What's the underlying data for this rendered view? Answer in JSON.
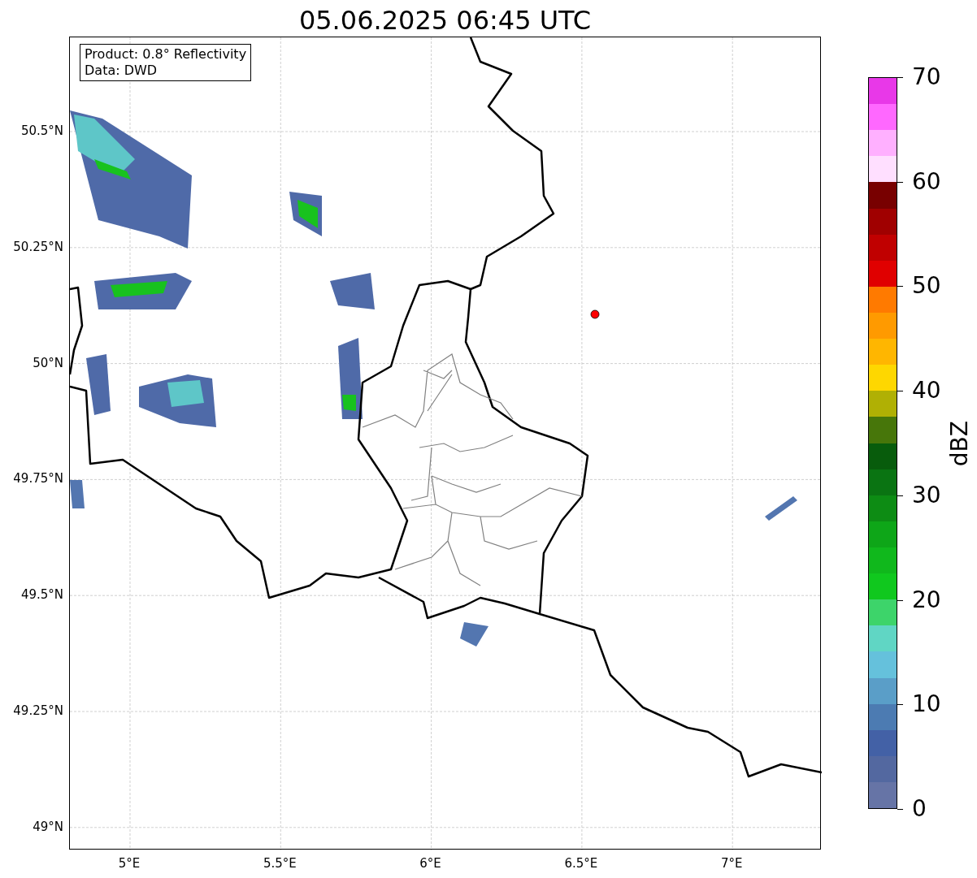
{
  "title": "05.06.2025 06:45 UTC",
  "info_box": {
    "lines": [
      "Product: 0.8° Reflectivity",
      "Data: DWD"
    ]
  },
  "map": {
    "y_ticks": [
      "50.5°N",
      "50.25°N",
      "50°N",
      "49.75°N",
      "49.5°N",
      "49.25°N",
      "49°N"
    ],
    "x_ticks": [
      "5°E",
      "5.5°E",
      "6°E",
      "6.5°E",
      "7°E"
    ]
  },
  "colorbar": {
    "label": "dBZ",
    "ticks": [
      "70",
      "60",
      "50",
      "40",
      "30",
      "20",
      "10",
      "0"
    ],
    "bands": [
      {
        "color": "#e838e8"
      },
      {
        "color": "#ff68ff"
      },
      {
        "color": "#ffb0ff"
      },
      {
        "color": "#ffdfff"
      },
      {
        "color": "#780000"
      },
      {
        "color": "#a00000"
      },
      {
        "color": "#c00000"
      },
      {
        "color": "#e00000"
      },
      {
        "color": "#ff7a00"
      },
      {
        "color": "#ff9a00"
      },
      {
        "color": "#ffb600"
      },
      {
        "color": "#fed700"
      },
      {
        "color": "#b0b004"
      },
      {
        "color": "#47760a"
      },
      {
        "color": "#085c0c"
      },
      {
        "color": "#0a7412"
      },
      {
        "color": "#0d8c14"
      },
      {
        "color": "#0ea618"
      },
      {
        "color": "#10b81c"
      },
      {
        "color": "#10c81e"
      },
      {
        "color": "#3dd46a"
      },
      {
        "color": "#60d6c4"
      },
      {
        "color": "#65c1dc"
      },
      {
        "color": "#5a9ec8"
      },
      {
        "color": "#4c7bb2"
      },
      {
        "color": "#4361a6"
      },
      {
        "color": "#5368a0"
      },
      {
        "color": "#6674a6"
      }
    ]
  }
}
